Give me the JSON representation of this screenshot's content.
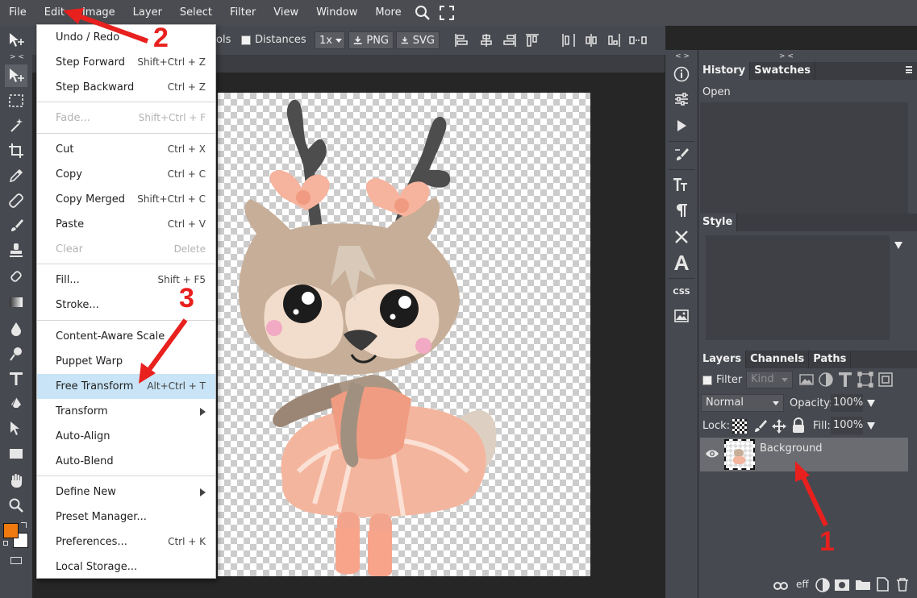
{
  "menubar": {
    "items": [
      "File",
      "Edit",
      "Image",
      "Layer",
      "Select",
      "Filter",
      "View",
      "Window",
      "More"
    ]
  },
  "options_bar": {
    "tools_partial": "ols",
    "distances_label": "Distances",
    "zoom": "1x",
    "png_label": "PNG",
    "svg_label": "SVG"
  },
  "edit_menu": {
    "items": [
      {
        "label": "Undo / Redo",
        "shortcut": ""
      },
      {
        "label": "Step Forward",
        "shortcut": "Shift+Ctrl + Z"
      },
      {
        "label": "Step Backward",
        "shortcut": "Ctrl + Z"
      },
      {
        "label": "Fade...",
        "shortcut": "Shift+Ctrl + F"
      },
      {
        "label": "Cut",
        "shortcut": "Ctrl + X"
      },
      {
        "label": "Copy",
        "shortcut": "Ctrl + C"
      },
      {
        "label": "Copy Merged",
        "shortcut": "Shift+Ctrl + C"
      },
      {
        "label": "Paste",
        "shortcut": "Ctrl + V"
      },
      {
        "label": "Clear",
        "shortcut": "Delete"
      },
      {
        "label": "Fill...",
        "shortcut": "Shift + F5"
      },
      {
        "label": "Stroke...",
        "shortcut": ""
      },
      {
        "label": "Content-Aware Scale",
        "shortcut": ""
      },
      {
        "label": "Puppet Warp",
        "shortcut": ""
      },
      {
        "label": "Free Transform",
        "shortcut": "Alt+Ctrl + T"
      },
      {
        "label": "Transform",
        "shortcut": ""
      },
      {
        "label": "Auto-Align",
        "shortcut": ""
      },
      {
        "label": "Auto-Blend",
        "shortcut": ""
      },
      {
        "label": "Define New",
        "shortcut": ""
      },
      {
        "label": "Preset Manager...",
        "shortcut": ""
      },
      {
        "label": "Preferences...",
        "shortcut": "Ctrl + K"
      },
      {
        "label": "Local Storage...",
        "shortcut": ""
      }
    ]
  },
  "history_panel": {
    "tabs": [
      "History",
      "Swatches"
    ],
    "entries": [
      "Open"
    ]
  },
  "style_panel": {
    "tab": "Style"
  },
  "layers_panel": {
    "tabs": [
      "Layers",
      "Channels",
      "Paths"
    ],
    "filter_label": "Filter",
    "kind_label": "Kind",
    "blend_mode": "Normal",
    "opacity_label": "Opacity:",
    "opacity_value": "100%",
    "lock_label": "Lock:",
    "fill_label": "Fill:",
    "fill_value": "100%",
    "layers": [
      {
        "name": "Background"
      }
    ],
    "footer_eff": "eff"
  },
  "colors": {
    "foreground": "#f07a10",
    "background": "#ffffff",
    "highlight": "#c8e4f6",
    "annotation": "#e8201e"
  },
  "annotations": [
    "1",
    "2",
    "3"
  ],
  "panel_collapse": "> <",
  "panel_collapse2": "< >"
}
